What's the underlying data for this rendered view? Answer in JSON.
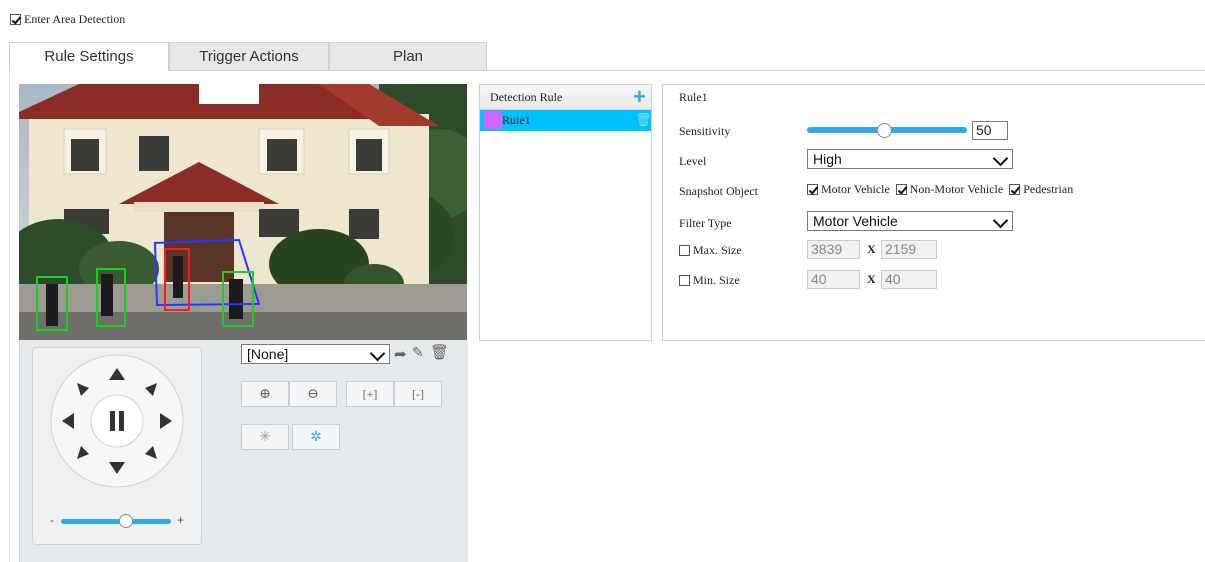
{
  "enable": {
    "label": "Enter Area Detection",
    "checked": true
  },
  "tabs": [
    {
      "label": "Rule Settings",
      "active": true
    },
    {
      "label": "Trigger Actions",
      "active": false
    },
    {
      "label": "Plan",
      "active": false
    }
  ],
  "ptz": {
    "preset_value": "[None]",
    "zoom_slider_min_label": "-",
    "zoom_slider_max_label": "+",
    "zoom_level": 0.62
  },
  "rules_panel": {
    "header": "Detection Rule",
    "items": [
      {
        "label": "Rule1",
        "color": "#cc66ff",
        "selected": true
      }
    ]
  },
  "settings": {
    "title": "Rule1",
    "sensitivity": {
      "label": "Sensitivity",
      "value": "50"
    },
    "level": {
      "label": "Level",
      "value": "High"
    },
    "snapshot": {
      "label": "Snapshot Object",
      "options": [
        {
          "label": "Motor Vehicle",
          "checked": true
        },
        {
          "label": "Non-Motor Vehicle",
          "checked": true
        },
        {
          "label": "Pedestrian",
          "checked": true
        }
      ]
    },
    "filter_type": {
      "label": "Filter Type",
      "value": "Motor Vehicle"
    },
    "max_size": {
      "label": "Max. Size",
      "checked": false,
      "width": "3839",
      "sep": "X",
      "height": "2159"
    },
    "min_size": {
      "label": "Min. Size",
      "checked": false,
      "width": "40",
      "sep": "X",
      "height": "40"
    }
  },
  "colors": {
    "accent": "#33a8e8",
    "selected_row": "#00c0ff",
    "rule_color": "#cc66ff"
  }
}
